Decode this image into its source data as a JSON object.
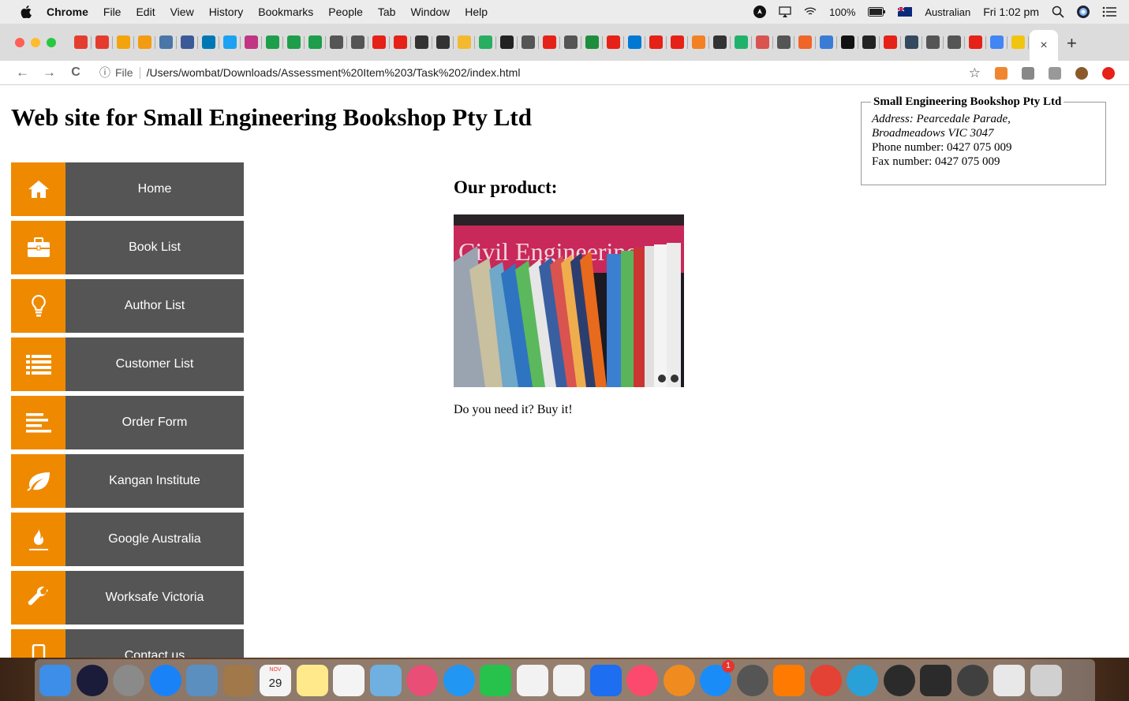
{
  "menubar": {
    "app_name": "Chrome",
    "menus": [
      "File",
      "Edit",
      "View",
      "History",
      "Bookmarks",
      "People",
      "Tab",
      "Window",
      "Help"
    ],
    "battery": "100%",
    "input_source": "Australian",
    "clock": "Fri 1:02 pm"
  },
  "tabstrip": {
    "favicon_colors": [
      "#e43d30",
      "#e43d30",
      "#f3a40c",
      "#f39c12",
      "#4a76a8",
      "#3b5998",
      "#0077b5",
      "#1da1f2",
      "#c13584",
      "#1e9e4a",
      "#1e9e4a",
      "#1e9e4a",
      "#555555",
      "#555555",
      "#e62117",
      "#e62117",
      "#333333",
      "#333333",
      "#f3ba2f",
      "#27ae60",
      "#222222",
      "#555555",
      "#e62117",
      "#555555",
      "#1e8e3e",
      "#e62117",
      "#0078d4",
      "#e62117",
      "#e62117",
      "#f48024",
      "#333333",
      "#20b26b",
      "#d9534f",
      "#555555",
      "#f06529",
      "#3a7bd5",
      "#111111",
      "#222222",
      "#e62117",
      "#34495e",
      "#555555",
      "#555555",
      "#e62117",
      "#4285f4",
      "#f1c40f",
      "#4285f4"
    ],
    "close_glyph": "×",
    "new_tab_glyph": "+"
  },
  "toolbar": {
    "back_glyph": "←",
    "forward_glyph": "→",
    "reload_glyph": "C",
    "info_glyph": "ⓘ",
    "scheme": "File",
    "url": "/Users/wombat/Downloads/Assessment%20Item%203/Task%202/index.html",
    "star_glyph": "☆",
    "extension_colors": [
      "#f0862f",
      "#888888",
      "#999999",
      "#8b5a2b",
      "#e62117"
    ]
  },
  "page": {
    "title": "Web site for Small Engineering Bookshop Pty Ltd",
    "nav": [
      {
        "label": "Home",
        "icon": "home-icon"
      },
      {
        "label": "Book List",
        "icon": "briefcase-icon"
      },
      {
        "label": "Author List",
        "icon": "lightbulb-icon"
      },
      {
        "label": "Customer List",
        "icon": "list-icon"
      },
      {
        "label": "Order Form",
        "icon": "align-left-icon"
      },
      {
        "label": "Kangan Institute",
        "icon": "leaf-icon"
      },
      {
        "label": "Google Australia",
        "icon": "fire-icon"
      },
      {
        "label": "Worksafe Victoria",
        "icon": "wrench-icon"
      },
      {
        "label": "Contact us",
        "icon": "mobile-icon"
      }
    ],
    "contact": {
      "legend": "Small Engineering Bookshop Pty Ltd",
      "address_line1": "Address: Pearcedale Parade,",
      "address_line2": "Broadmeadows VIC 3047",
      "phone": "Phone number: 0427 075 009",
      "fax": "Fax number: 0427 075 009"
    },
    "product_heading": "Our product:",
    "product_image_text": "Civil Engineering",
    "product_text": "Do you need it? Buy it!"
  },
  "dock": {
    "calendar_month": "NOV",
    "calendar_day": "29",
    "app_store_badge": "1",
    "icon_colors": [
      "#3d8ee8",
      "#1b1b3a",
      "#8a8a8a",
      "#1a82f7",
      "#5a8fbf",
      "#a0784a",
      "#f4f4f4",
      "#ffe98a",
      "#f4f4f4",
      "#6fb0e0",
      "#e94e77",
      "#2196f3",
      "#27c24c",
      "#f2f2f2",
      "#f2f2f2",
      "#1d6ef0",
      "#fb4a6b",
      "#f08c1f",
      "#1a8cf7",
      "#555555",
      "#ff7a00",
      "#e34234",
      "#2aa0d8",
      "#2b2b2b",
      "#2b2b2b",
      "#404040",
      "#e8e8e8",
      "#d0d0d0"
    ]
  },
  "colors": {
    "nav_icon_bg": "#ef8a00",
    "nav_label_bg": "#555555"
  }
}
